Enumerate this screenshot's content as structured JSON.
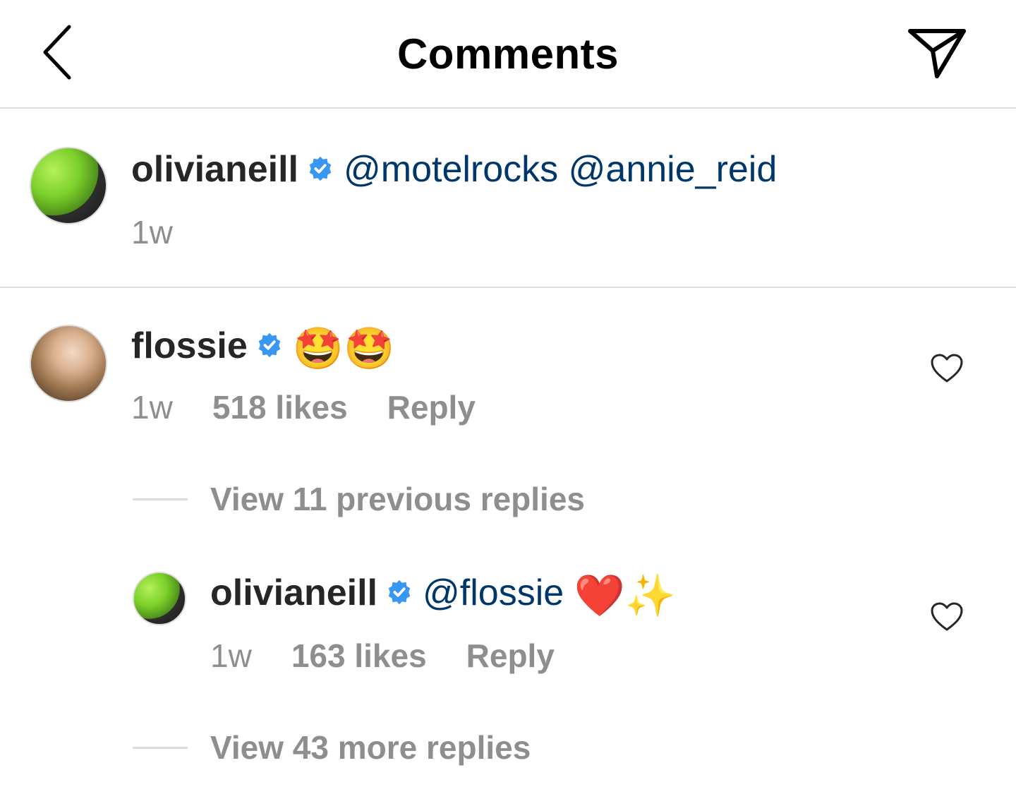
{
  "header": {
    "title": "Comments",
    "back_icon": "chevron-left-icon",
    "share_icon": "paper-plane-icon"
  },
  "caption": {
    "username": "olivianeill",
    "verified": true,
    "mentions": [
      "@motelrocks",
      "@annie_reid"
    ],
    "time": "1w"
  },
  "comments": [
    {
      "username": "flossie",
      "verified": true,
      "emoji": "🤩🤩",
      "time": "1w",
      "likes": "518 likes",
      "reply_label": "Reply",
      "view_previous": "View 11 previous replies",
      "replies": [
        {
          "username": "olivianeill",
          "verified": true,
          "mention": "@flossie",
          "emoji": "❤️✨",
          "time": "1w",
          "likes": "163 likes",
          "reply_label": "Reply"
        }
      ],
      "view_more": "View 43 more replies"
    }
  ],
  "colors": {
    "mention": "#00376b",
    "verified": "#3897f0",
    "secondary_text": "#8e8e8e",
    "divider": "#dbdbdb"
  }
}
